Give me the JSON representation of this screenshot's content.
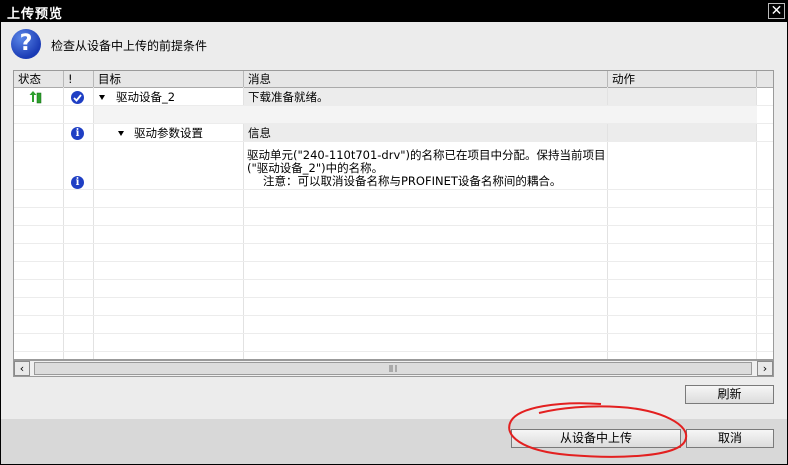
{
  "window": {
    "title": "上传预览",
    "close_glyph": "✕"
  },
  "header": {
    "text": "检查从设备中上传的前提条件",
    "icon": "question-icon"
  },
  "table": {
    "columns": [
      "状态",
      "!",
      "目标",
      "消息",
      "动作"
    ],
    "rows": [
      {
        "status_icon": "upload-arrow-icon",
        "flag_icon": "check-icon",
        "target": "驱动设备_2",
        "message": "下载准备就绪。",
        "action": ""
      },
      {
        "target": "",
        "message": "",
        "action": ""
      },
      {
        "flag_icon": "info-icon",
        "target": "驱动参数设置",
        "message": "信息",
        "action": ""
      }
    ],
    "detail_message": {
      "line1": "驱动单元(\"240-110t701-drv\")的名称已在项目中分配。保持当前项目",
      "line2": "(\"驱动设备_2\")中的名称。",
      "line3": "注意：可以取消设备名称与PROFINET设备名称间的耦合。"
    }
  },
  "buttons": {
    "refresh": "刷新",
    "upload": "从设备中上传",
    "cancel": "取消"
  }
}
